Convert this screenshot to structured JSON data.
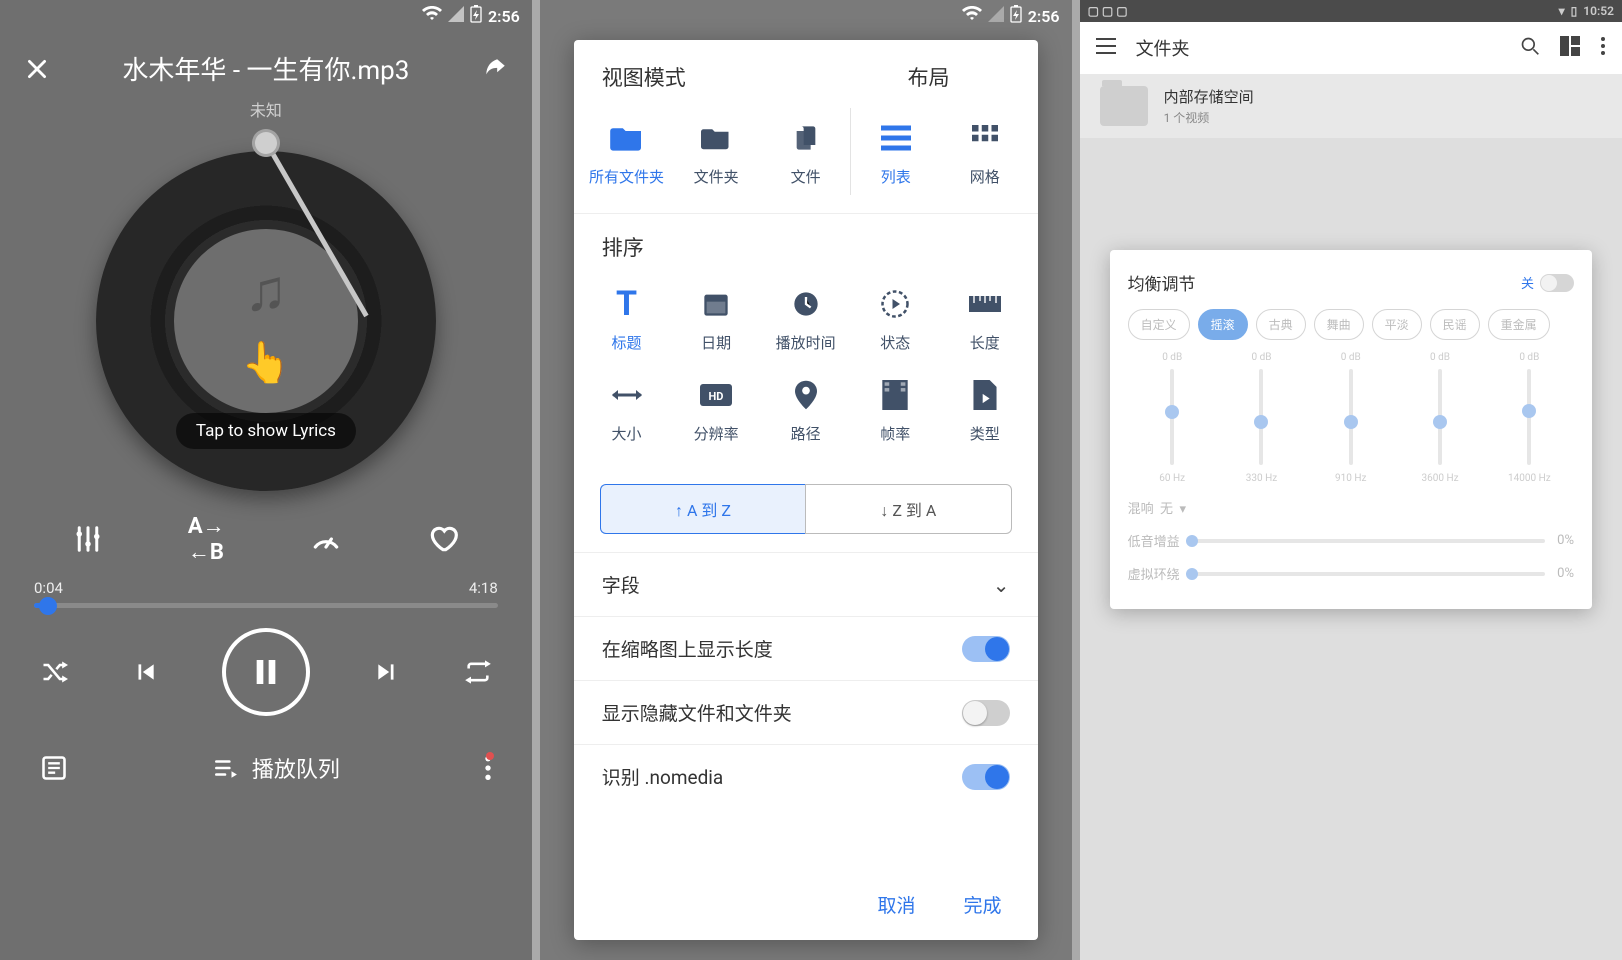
{
  "status": {
    "time": "2:56",
    "time3": "10:52"
  },
  "player": {
    "title": "水木年华 - 一生有你.mp3",
    "artist": "未知",
    "lyrics_hint": "Tap to show Lyrics",
    "elapsed": "0:04",
    "total": "4:18",
    "queue_label": "播放队列"
  },
  "sheet": {
    "view_mode_label": "视图模式",
    "layout_label": "布局",
    "view_items": [
      "所有文件夹",
      "文件夹",
      "文件"
    ],
    "layout_items": [
      "列表",
      "网格"
    ],
    "sort_label": "排序",
    "sort_items": [
      "标题",
      "日期",
      "播放时间",
      "状态",
      "长度",
      "大小",
      "分辨率",
      "路径",
      "帧率",
      "类型"
    ],
    "dir_asc": "↑  A 到 Z",
    "dir_desc": "↓  Z 到 A",
    "section_fields": "字段",
    "toggle1": "在缩略图上显示长度",
    "toggle2": "显示隐藏文件和文件夹",
    "toggle3": "识别 .nomedia",
    "cancel": "取消",
    "done": "完成"
  },
  "s3": {
    "appbar_title": "文件夹",
    "folder_title": "内部存储空间",
    "folder_sub": "1 个视频",
    "eq_title": "均衡调节",
    "eq_off": "关",
    "chips": [
      "自定义",
      "摇滚",
      "古典",
      "舞曲",
      "平淡",
      "民谣",
      "重金属"
    ],
    "bands": [
      {
        "db": "0 dB",
        "hz": "60 Hz",
        "pos": 38
      },
      {
        "db": "0 dB",
        "hz": "330 Hz",
        "pos": 48
      },
      {
        "db": "0 dB",
        "hz": "910 Hz",
        "pos": 48
      },
      {
        "db": "0 dB",
        "hz": "3600 Hz",
        "pos": 48
      },
      {
        "db": "0 dB",
        "hz": "14000 Hz",
        "pos": 36
      }
    ],
    "reverb_label": "混响",
    "reverb_value": "无",
    "row2_label": "低音增益",
    "row2_val": "0%",
    "row3_label": "虚拟环绕",
    "row3_val": "0%"
  }
}
